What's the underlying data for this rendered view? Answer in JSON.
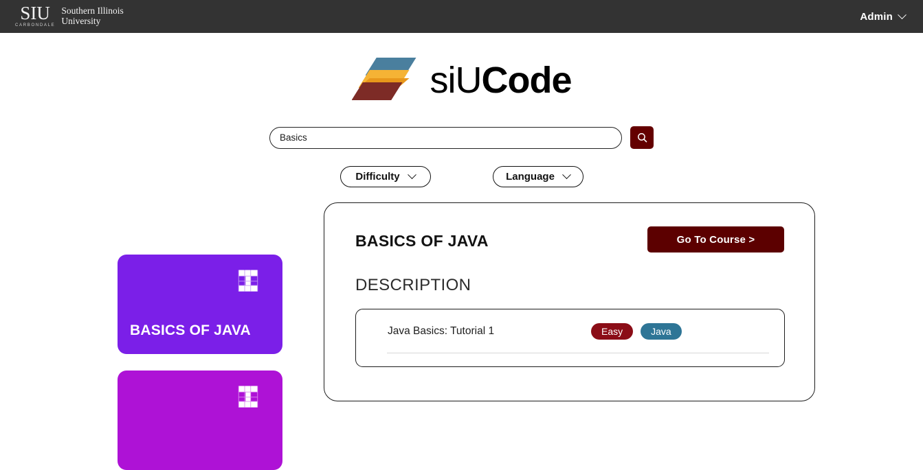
{
  "topbar": {
    "university_mark": "SIU",
    "university_sub": "CARBONDALE",
    "university_name_line1": "Southern Illinois",
    "university_name_line2": "University",
    "account_label": "Admin",
    "account_caret_icon": "chevron-down-icon",
    "background_color": "#333333"
  },
  "brand": {
    "text_light": "siU",
    "text_bold": "Code",
    "logo_icon": "stacked-layers-logo",
    "layer_colors": [
      "#4a7f9e",
      "#f5b335",
      "#e8971b",
      "#7d2b26"
    ]
  },
  "search": {
    "value": "Basics",
    "placeholder": "Search",
    "button_icon": "search-icon",
    "button_color": "#640000"
  },
  "filters": [
    {
      "label": "Difficulty",
      "caret_icon": "chevron-down-icon"
    },
    {
      "label": "Language",
      "caret_icon": "chevron-down-icon"
    }
  ],
  "course_cards": [
    {
      "title": "BASICS OF JAVA",
      "color": "#7b1fe8",
      "icon": "image-placeholder-icon"
    },
    {
      "title": "",
      "color": "#ae12d6",
      "icon": "image-placeholder-icon"
    }
  ],
  "detail": {
    "title": "BASICS OF JAVA",
    "go_to_course_label": "Go To Course >",
    "go_to_course_color": "#5c0000",
    "description_heading": "DESCRIPTION",
    "tutorials": [
      {
        "name": "Java Basics: Tutorial 1",
        "difficulty_badge": "Easy",
        "difficulty_color": "#8b0d17",
        "language_badge": "Java",
        "language_color": "#2e7596"
      }
    ]
  }
}
